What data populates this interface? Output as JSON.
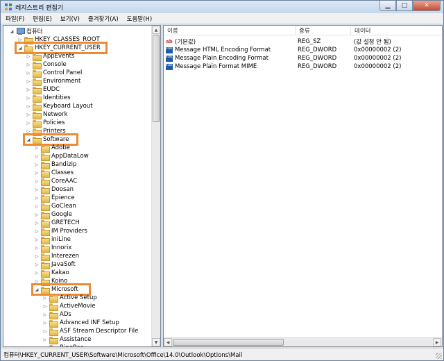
{
  "window": {
    "title": "레지스트리 편집기"
  },
  "menu": [
    "파일(F)",
    "편집(E)",
    "보기(V)",
    "즐겨찾기(A)",
    "도움말(H)"
  ],
  "tree": [
    {
      "label": "컴퓨터",
      "level": 0,
      "expand": "open",
      "icon": "computer-icon"
    },
    {
      "label": "HKEY_CLASSES_ROOT",
      "level": 1,
      "expand": "closed",
      "icon": "folder-icon"
    },
    {
      "label": "HKEY_CURRENT_USER",
      "level": 1,
      "expand": "open",
      "icon": "folder-icon",
      "highlight": true
    },
    {
      "label": "AppEvents",
      "level": 2,
      "expand": "closed",
      "icon": "folder-icon"
    },
    {
      "label": "Console",
      "level": 2,
      "expand": "closed",
      "icon": "folder-icon"
    },
    {
      "label": "Control Panel",
      "level": 2,
      "expand": "closed",
      "icon": "folder-icon"
    },
    {
      "label": "Environment",
      "level": 2,
      "expand": "closed",
      "icon": "folder-icon"
    },
    {
      "label": "EUDC",
      "level": 2,
      "expand": "closed",
      "icon": "folder-icon"
    },
    {
      "label": "Identities",
      "level": 2,
      "expand": "closed",
      "icon": "folder-icon"
    },
    {
      "label": "Keyboard Layout",
      "level": 2,
      "expand": "closed",
      "icon": "folder-icon"
    },
    {
      "label": "Network",
      "level": 2,
      "expand": "closed",
      "icon": "folder-icon"
    },
    {
      "label": "Policies",
      "level": 2,
      "expand": "closed",
      "icon": "folder-icon"
    },
    {
      "label": "Printers",
      "level": 2,
      "expand": "closed",
      "icon": "folder-icon"
    },
    {
      "label": "Software",
      "level": 2,
      "expand": "open",
      "icon": "folder-icon",
      "highlight": true
    },
    {
      "label": "Adobe",
      "level": 3,
      "expand": "closed",
      "icon": "folder-icon"
    },
    {
      "label": "AppDataLow",
      "level": 3,
      "expand": "closed",
      "icon": "folder-icon"
    },
    {
      "label": "Bandizip",
      "level": 3,
      "expand": "closed",
      "icon": "folder-icon"
    },
    {
      "label": "Classes",
      "level": 3,
      "expand": "closed",
      "icon": "folder-icon"
    },
    {
      "label": "CoreAAC",
      "level": 3,
      "expand": "closed",
      "icon": "folder-icon"
    },
    {
      "label": "Doosan",
      "level": 3,
      "expand": "closed",
      "icon": "folder-icon"
    },
    {
      "label": "Epience",
      "level": 3,
      "expand": "closed",
      "icon": "folder-icon"
    },
    {
      "label": "GoClean",
      "level": 3,
      "expand": "closed",
      "icon": "folder-icon"
    },
    {
      "label": "Google",
      "level": 3,
      "expand": "closed",
      "icon": "folder-icon"
    },
    {
      "label": "GRETECH",
      "level": 3,
      "expand": "closed",
      "icon": "folder-icon"
    },
    {
      "label": "IM Providers",
      "level": 3,
      "expand": "closed",
      "icon": "folder-icon"
    },
    {
      "label": "iniLine",
      "level": 3,
      "expand": "closed",
      "icon": "folder-icon"
    },
    {
      "label": "Innorix",
      "level": 3,
      "expand": "closed",
      "icon": "folder-icon"
    },
    {
      "label": "Interezen",
      "level": 3,
      "expand": "closed",
      "icon": "folder-icon"
    },
    {
      "label": "JavaSoft",
      "level": 3,
      "expand": "closed",
      "icon": "folder-icon"
    },
    {
      "label": "Kakao",
      "level": 3,
      "expand": "closed",
      "icon": "folder-icon"
    },
    {
      "label": "Koino",
      "level": 3,
      "expand": "closed",
      "icon": "folder-icon"
    },
    {
      "label": "Microsoft",
      "level": 3,
      "expand": "open",
      "icon": "folder-icon",
      "highlight": true
    },
    {
      "label": "Active Setup",
      "level": 4,
      "expand": "closed",
      "icon": "folder-icon"
    },
    {
      "label": "ActiveMovie",
      "level": 4,
      "expand": "closed",
      "icon": "folder-icon"
    },
    {
      "label": "ADs",
      "level": 4,
      "expand": "closed",
      "icon": "folder-icon"
    },
    {
      "label": "Advanced INF Setup",
      "level": 4,
      "expand": "closed",
      "icon": "folder-icon"
    },
    {
      "label": "ASF Stream Descriptor File",
      "level": 4,
      "expand": "closed",
      "icon": "folder-icon"
    },
    {
      "label": "Assistance",
      "level": 4,
      "expand": "closed",
      "icon": "folder-icon"
    },
    {
      "label": "BingBar",
      "level": 4,
      "expand": "closed",
      "icon": "folder-icon"
    }
  ],
  "list": {
    "columns": [
      "이름",
      "종류",
      "데이터"
    ],
    "rows": [
      {
        "name": "(기본값)",
        "type": "REG_SZ",
        "data": "(값 설정 안 됨)",
        "icon": "string-value-icon"
      },
      {
        "name": "Message HTML Encoding Format",
        "type": "REG_DWORD",
        "data": "0x00000002 (2)",
        "icon": "binary-value-icon"
      },
      {
        "name": "Message Plain Encoding Format",
        "type": "REG_DWORD",
        "data": "0x00000002 (2)",
        "icon": "binary-value-icon"
      },
      {
        "name": "Message Plain Format MIME",
        "type": "REG_DWORD",
        "data": "0x00000002 (2)",
        "icon": "binary-value-icon"
      }
    ]
  },
  "status": "컴퓨터\\HKEY_CURRENT_USER\\Software\\Microsoft\\Office\\14.0\\Outlook\\Options\\Mail"
}
